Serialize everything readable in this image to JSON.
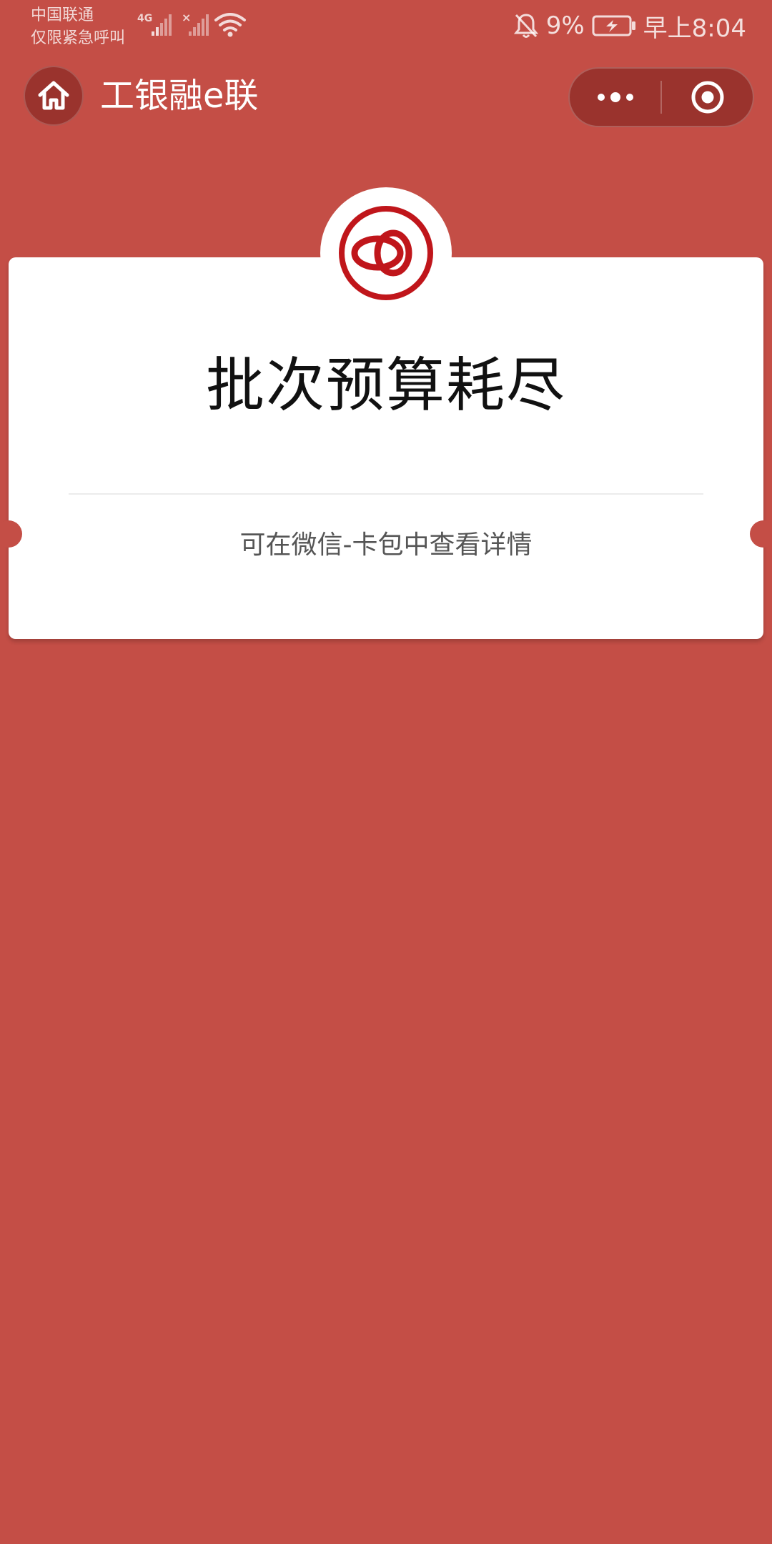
{
  "status_bar": {
    "carrier_line1": "中国联通",
    "carrier_line2": "仅限紧急呼叫",
    "network": "4G",
    "battery_percent": "9%",
    "time": "早上8:04"
  },
  "nav": {
    "title": "工银融e联"
  },
  "card": {
    "title": "批次预算耗尽",
    "subtitle": "可在微信-卡包中查看详情"
  },
  "colors": {
    "background": "#c44e46",
    "logo_red": "#c0161b",
    "card": "#ffffff"
  },
  "icons": [
    "home-icon",
    "more-dots-icon",
    "close-target-icon",
    "bank-logo-icon",
    "mute-icon",
    "battery-charging-icon",
    "wifi-icon",
    "signal-icon"
  ]
}
